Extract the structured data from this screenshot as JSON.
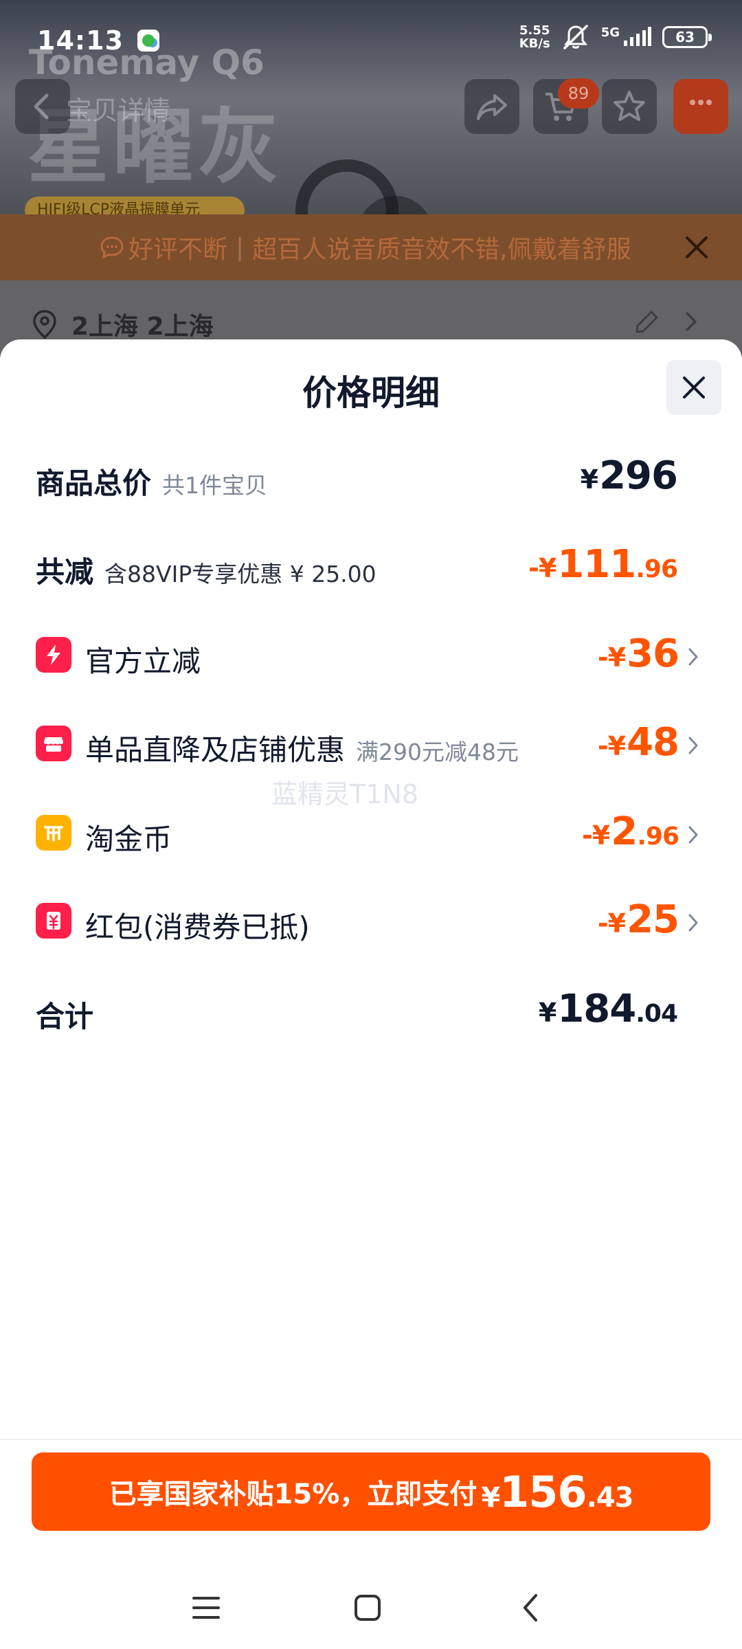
{
  "status_bar": {
    "time": "14:13",
    "net_speed_value": "5.55",
    "net_speed_unit": "KB/s",
    "network": "5G",
    "battery": "63"
  },
  "background": {
    "brand": "Tonemay Q6",
    "hero_title": "星曜灰",
    "tag": "HIFI级LCP液晶振膜单元",
    "back_label": "宝贝详情",
    "cart_badge": "89",
    "review_banner": {
      "label": "好评不断",
      "text": "超百人说音质音效不错,佩戴着舒服"
    },
    "address": "2上海 2上海"
  },
  "sheet": {
    "title": "价格明细",
    "rows": [
      {
        "label": "商品总价",
        "sub": "共1件宝贝",
        "amount_cur": "¥",
        "amount_int": "296",
        "amount_dec": ""
      },
      {
        "label": "共减",
        "sub": "含88VIP专享优惠 ¥ 25.00",
        "amount_cur": "-¥",
        "amount_int": "111",
        "amount_dec": ".96"
      },
      {
        "label": "官方立减",
        "sub": "",
        "amount_cur": "-¥",
        "amount_int": "36",
        "amount_dec": ""
      },
      {
        "label": "单品直降及店铺优惠",
        "sub": "满290元减48元",
        "amount_cur": "-¥",
        "amount_int": "48",
        "amount_dec": ""
      },
      {
        "label": "淘金币",
        "sub": "",
        "amount_cur": "-¥",
        "amount_int": "2",
        "amount_dec": ".96"
      },
      {
        "label": "红包(消费券已抵)",
        "sub": "",
        "amount_cur": "-¥",
        "amount_int": "25",
        "amount_dec": ""
      },
      {
        "label": "合计",
        "sub": "",
        "amount_cur": "¥",
        "amount_int": "184",
        "amount_dec": ".04"
      }
    ],
    "watermark": "蓝精灵T1N8"
  },
  "pay_button": {
    "label": "已享国家补贴15%，立即支付",
    "cur": "¥",
    "int": "156",
    "dec": ".43"
  },
  "colors": {
    "accent_orange": "#ff5000",
    "discount_orange": "#ff5500",
    "icon_red": "#ff1f4b",
    "icon_yellow": "#ffb300",
    "text_dark": "#11192d",
    "text_muted": "#7f8898"
  },
  "icons": {
    "lightning": "lightning-icon",
    "shop": "shop-icon",
    "coin": "coin-icon",
    "red_packet": "red-packet-icon"
  }
}
